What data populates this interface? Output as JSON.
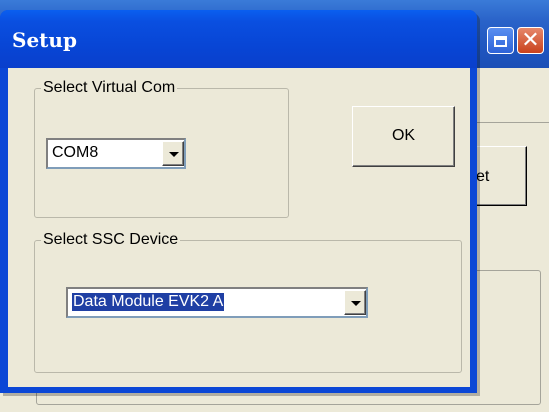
{
  "background_window": {
    "button_partial_label": "et"
  },
  "dialog": {
    "title": "Setup",
    "com_group": {
      "legend": "Select Virtual Com",
      "selected_value": "COM8"
    },
    "ssc_group": {
      "legend": "Select SSC Device",
      "selected_value": "Data Module EVK2 A"
    },
    "ok_label": "OK"
  },
  "icons": {
    "maximize": "maximize-icon",
    "close": "close-icon",
    "dropdown": "chevron-down-icon"
  },
  "colors": {
    "title_bar_blue": "#0846d6",
    "close_red": "#c9421c",
    "dialog_face": "#ece9d8",
    "selection_blue": "#1f3fa4"
  }
}
